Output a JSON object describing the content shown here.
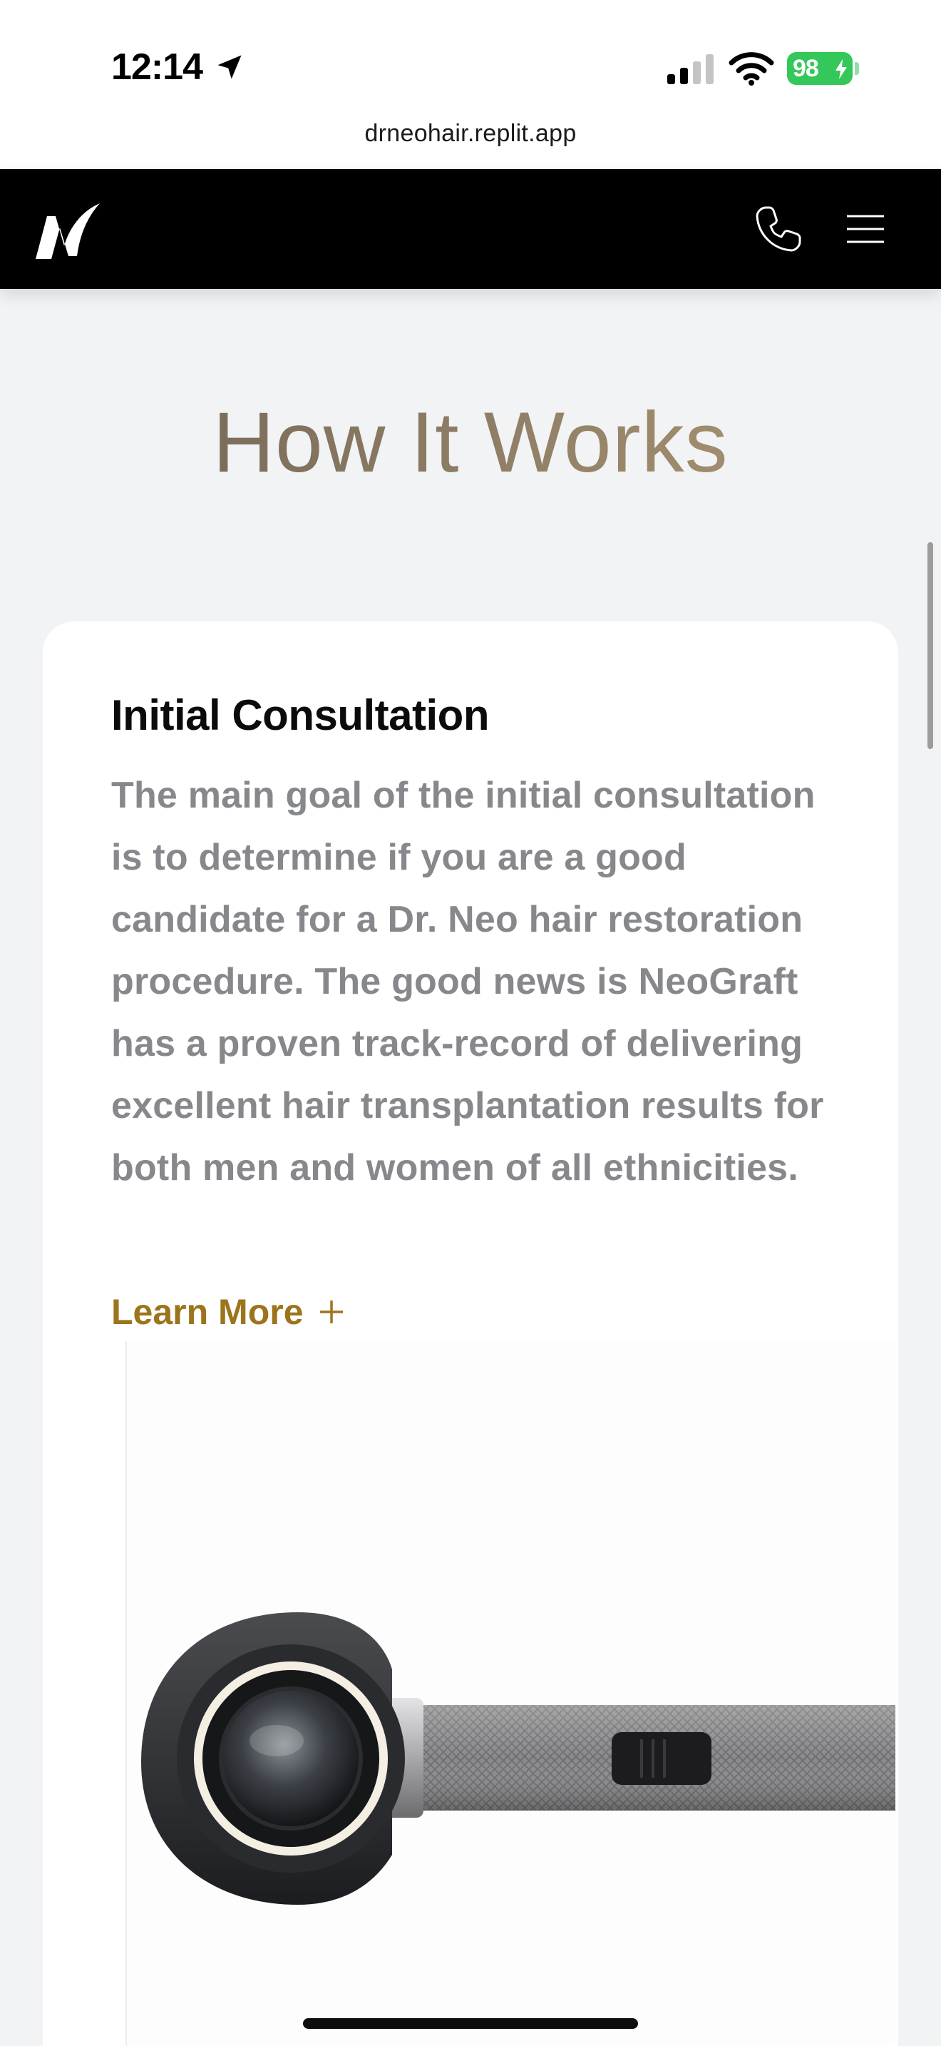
{
  "status_bar": {
    "time": "12:14",
    "battery": "98",
    "battery_color": "#34c759",
    "icons": [
      "location-arrow-icon",
      "cellular-signal-icon",
      "wifi-icon",
      "battery-icon"
    ]
  },
  "browser": {
    "url": "drneohair.replit.app"
  },
  "header": {
    "logo_icon": "neo-logo",
    "phone_icon": "phone-icon",
    "menu_icon": "hamburger-menu-icon",
    "background": "#000000"
  },
  "section": {
    "title": "How It Works"
  },
  "card": {
    "title": "Initial Consultation",
    "body": "The main goal of the initial consultation is to determine if you are a good candidate for a Dr. Neo hair restoration procedure. The good news is NeoGraft has a proven track-record of delivering excellent hair transplantation results for both men and women of all ethnicities.",
    "learn_more": "Learn More",
    "learn_more_icon": "plus-icon",
    "accent": "#9c741c",
    "image": "dermatoscope-device-image"
  }
}
